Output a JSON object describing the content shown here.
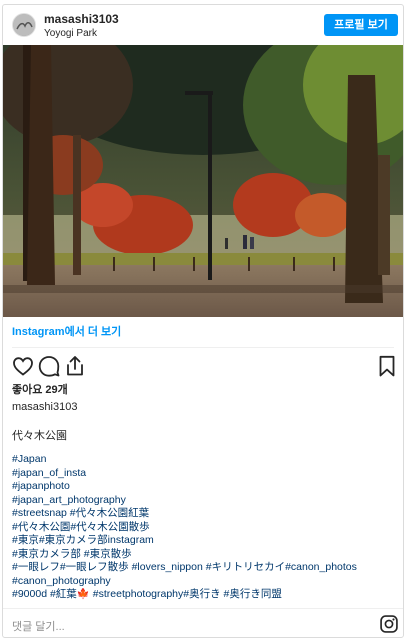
{
  "header": {
    "username": "masashi3103",
    "location": "Yoyogi Park",
    "profile_button": "프로필 보기"
  },
  "post": {
    "image_alt": "autumn trees in Yoyogi Park",
    "view_more": "Instagram에서 더 보기",
    "likes": "좋아요 29개",
    "caption_user": "masashi3103",
    "caption_text": "代々木公園",
    "hashtag_lines": [
      "#Japan",
      "#japan_of_insta",
      "#japanphoto",
      "#japan_art_photography",
      "#streetsnap #代々木公園紅葉",
      "#代々木公園#代々木公園散歩",
      "#東京#東京カメラ部instagram",
      "#東京カメラ部 #東京散歩",
      "#一眼レフ#一眼レフ散歩 #lovers_nippon #キリトリセカイ#canon_photos",
      "#canon_photography",
      "#9000d #紅葉🍁 #streetphotography#奥行き #奥行き同盟"
    ]
  },
  "comment": {
    "placeholder": "댓글 달기..."
  },
  "icons": {
    "like": "heart-icon",
    "comment": "comment-icon",
    "share": "share-icon",
    "save": "bookmark-icon",
    "instagram": "instagram-icon"
  },
  "colors": {
    "accent": "#0095f6",
    "hashtag": "#00376b",
    "muted": "#8e8e8e"
  }
}
